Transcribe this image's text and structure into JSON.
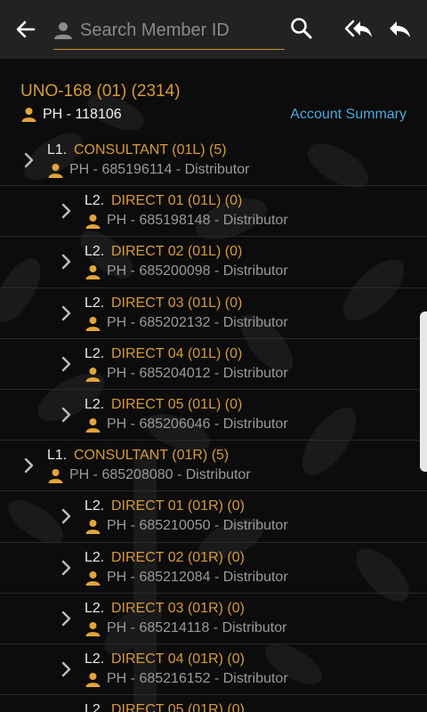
{
  "search": {
    "placeholder": "Search Member ID"
  },
  "root": {
    "title": "UNO-168 (01) (2314)",
    "phone": "PH - 118106",
    "account_summary_label": "Account Summary"
  },
  "colors": {
    "accent": "#d79a3a",
    "link": "#4ea8dd",
    "topbar": "#222222"
  },
  "icons": {
    "back": "arrow-left-icon",
    "search": "magnifier-icon",
    "reply_all": "reply-all-icon",
    "reply": "reply-icon",
    "person": "person-icon",
    "chevron": "chevron-right-icon"
  },
  "rows": [
    {
      "level": "L1.",
      "name": "CONSULTANT (01L) (5)",
      "info": "PH - 685196114 - Distributor"
    },
    {
      "level": "L2.",
      "name": "DIRECT 01 (01L) (0)",
      "info": "PH - 685198148 - Distributor"
    },
    {
      "level": "L2.",
      "name": "DIRECT 02 (01L) (0)",
      "info": "PH - 685200098 - Distributor"
    },
    {
      "level": "L2.",
      "name": "DIRECT 03 (01L) (0)",
      "info": "PH - 685202132 - Distributor"
    },
    {
      "level": "L2.",
      "name": "DIRECT 04 (01L) (0)",
      "info": "PH - 685204012 - Distributor"
    },
    {
      "level": "L2.",
      "name": "DIRECT 05 (01L) (0)",
      "info": "PH - 685206046 - Distributor"
    },
    {
      "level": "L1.",
      "name": "CONSULTANT (01R) (5)",
      "info": "PH - 685208080 - Distributor"
    },
    {
      "level": "L2.",
      "name": "DIRECT 01 (01R) (0)",
      "info": "PH - 685210050 - Distributor"
    },
    {
      "level": "L2.",
      "name": "DIRECT 02 (01R) (0)",
      "info": "PH - 685212084 - Distributor"
    },
    {
      "level": "L2.",
      "name": "DIRECT 03 (01R) (0)",
      "info": "PH - 685214118 - Distributor"
    },
    {
      "level": "L2.",
      "name": "DIRECT 04 (01R) (0)",
      "info": "PH - 685216152 - Distributor"
    },
    {
      "level": "L2.",
      "name": "DIRECT 05 (01R) (0)",
      "info": ""
    }
  ]
}
